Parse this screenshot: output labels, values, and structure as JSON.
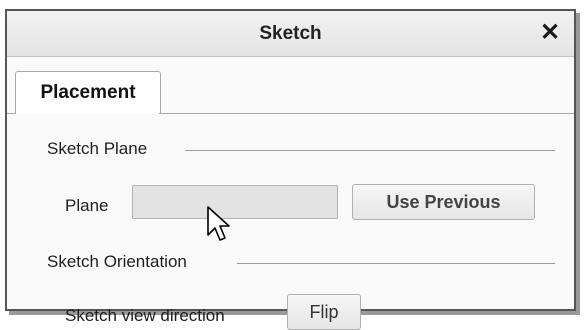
{
  "dialog": {
    "title": "Sketch",
    "close_glyph": "✕"
  },
  "tabs": [
    {
      "label": "Placement",
      "selected": true
    }
  ],
  "sketch_plane": {
    "section_label": "Sketch Plane",
    "plane_label": "Plane",
    "plane_value": "",
    "use_previous_label": "Use Previous"
  },
  "sketch_orientation": {
    "section_label": "Sketch Orientation",
    "view_direction_label": "Sketch view direction",
    "flip_label": "Flip"
  },
  "cursor": {
    "icon": "mouse-pointer-arrow-icon"
  },
  "colors": {
    "dialog_border": "#555555",
    "titlebar": "#e8e8e8",
    "input_bg": "#e3e3e3",
    "button_text": "#444444"
  }
}
